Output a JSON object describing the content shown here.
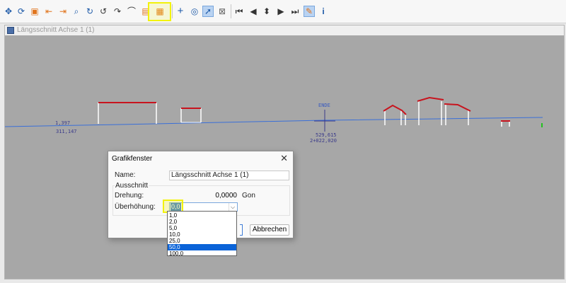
{
  "window": {
    "title": "Längsschnitt Achse 1 (1)"
  },
  "toolbar": {
    "icons": [
      "zoom-extents-icon",
      "refresh-icon",
      "layers-icon",
      "import-icon",
      "export-icon",
      "zoom-icon",
      "rotate-icon",
      "undo-icon",
      "redo-icon",
      "arc-icon",
      "plot-icon",
      "graphic-window-icon",
      "add-icon",
      "globe-icon",
      "pointer-icon",
      "table-icon",
      "first-icon",
      "prev-icon",
      "updown-icon",
      "next-icon",
      "last-icon",
      "edit-icon",
      "info-icon"
    ]
  },
  "canvas": {
    "left_value_top": "1,397",
    "left_value_bottom": "311,147",
    "end_label": "ENDE",
    "end_value_top": "529,615",
    "end_value_bottom": "2+022,020"
  },
  "dialog": {
    "title": "Grafikfenster",
    "close_glyph": "✕",
    "name_label": "Name:",
    "name_value": "Längsschnitt Achse 1 (1)",
    "group_label": "Ausschnitt",
    "rotation_label": "Drehung:",
    "rotation_value": "0,0000",
    "rotation_unit": "Gon",
    "exaggeration_label": "Überhöhung:",
    "exaggeration_value": "0,0",
    "cancel_label": "Abbrechen"
  },
  "dropdown": {
    "options": [
      "1,0",
      "2,0",
      "5,0",
      "10,0",
      "25,0",
      "50,0",
      "100,0"
    ],
    "selected_index": 5
  },
  "colors": {
    "highlight": "#f2f20a",
    "accent": "#0a63d8",
    "structure_roof": "#c8141e",
    "axis_line": "#3a6fd8"
  }
}
